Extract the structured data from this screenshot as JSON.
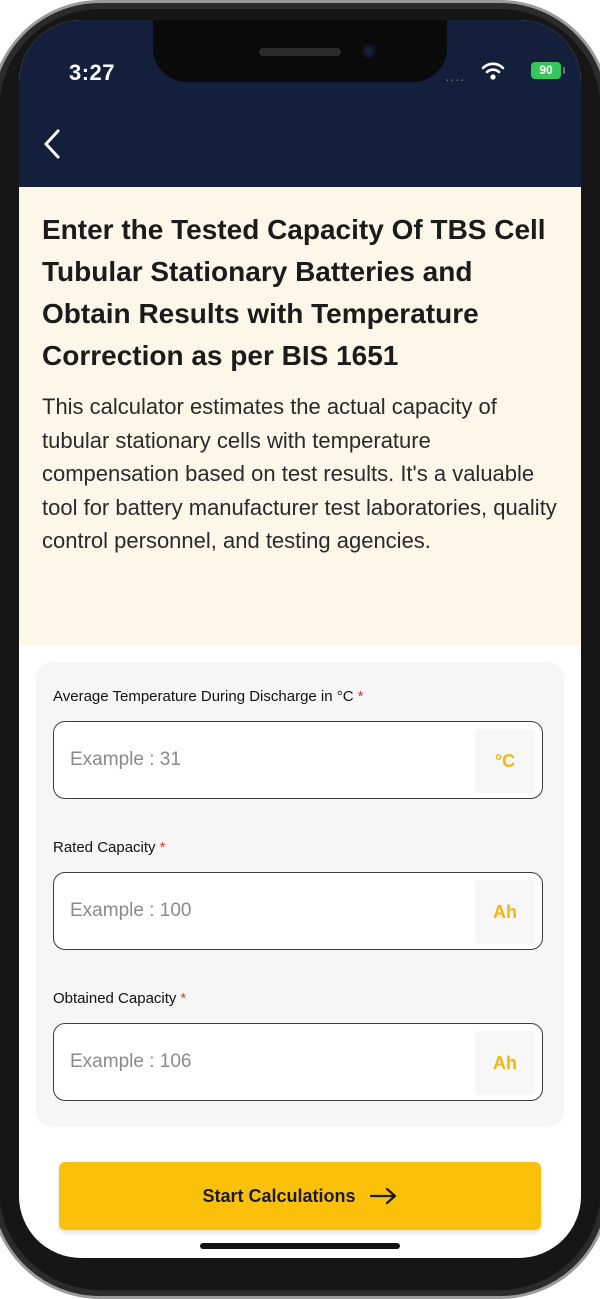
{
  "status_bar": {
    "time": "3:27",
    "signal": "....",
    "battery": "90"
  },
  "header": {
    "back_icon": "chevron-left-icon",
    "background_color": "#14203b"
  },
  "intro": {
    "title": "Enter the Tested Capacity Of TBS Cell Tubular Stationary Batteries and Obtain Results with Temperature Correction as per BIS 1651",
    "description": "This calculator estimates the actual capacity of tubular stationary cells with temperature compensation based on test results. It's a valuable tool for battery manufacturer test laboratories, quality control personnel, and testing agencies."
  },
  "form": {
    "fields": [
      {
        "label": "Average Temperature During Discharge in °C",
        "required_mark": "*",
        "placeholder": "Example : 31",
        "value": "",
        "unit": "°C"
      },
      {
        "label": "Rated Capacity",
        "required_mark": "*",
        "placeholder": "Example : 100",
        "value": "",
        "unit": "Ah"
      },
      {
        "label": "Obtained Capacity",
        "required_mark": "*",
        "placeholder": "Example : 106",
        "value": "",
        "unit": "Ah"
      }
    ]
  },
  "actions": {
    "start_label": "Start Calculations",
    "start_icon": "arrow-right-icon",
    "accent_color": "#fbc10a"
  }
}
